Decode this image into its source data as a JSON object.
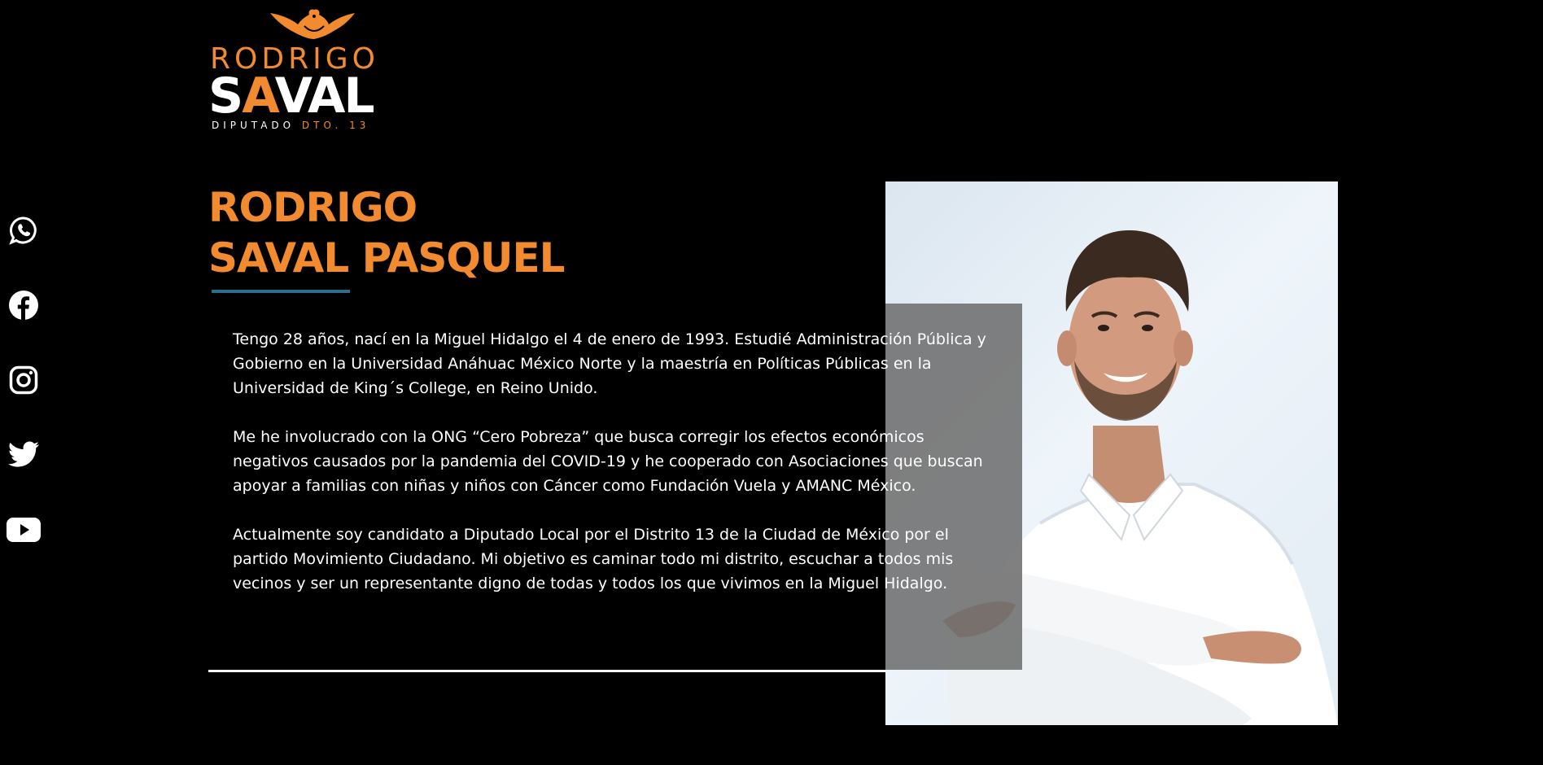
{
  "brand": {
    "logo_line1": "RODRIGO",
    "logo_line2_a": "S",
    "logo_line2_b": "A",
    "logo_line2_c": "VAL",
    "logo_line3_a": "DIPUTADO",
    "logo_line3_b": "DTO. 13",
    "accent_color": "#f28a30",
    "underline_color": "#2a6f8e"
  },
  "social": [
    {
      "name": "whatsapp",
      "icon": "whatsapp-icon"
    },
    {
      "name": "facebook",
      "icon": "facebook-icon"
    },
    {
      "name": "instagram",
      "icon": "instagram-icon"
    },
    {
      "name": "twitter",
      "icon": "twitter-icon"
    },
    {
      "name": "youtube",
      "icon": "youtube-icon"
    }
  ],
  "heading": {
    "line1": "RODRIGO",
    "line2": "SAVAL PASQUEL"
  },
  "bio": {
    "p1": "Tengo 28 años, nací en la Miguel Hidalgo el 4 de enero de 1993. Estudié Administración Pública y Gobierno en la Universidad Anáhuac México Norte y la maestría en Políticas Públicas en la Universidad de King´s College, en Reino Unido.",
    "p2": "Me he involucrado con la ONG “Cero Pobreza” que busca corregir los efectos económicos negativos causados por la pandemia del COVID-19 y he cooperado con Asociaciones que buscan apoyar a familias con niñas y niños con Cáncer como Fundación Vuela y AMANC México.",
    "p3": "Actualmente soy candidato a Diputado Local por el Distrito 13 de la Ciudad de México por el partido Movimiento Ciudadano. Mi objetivo es caminar todo mi distrito, escuchar a todos mis vecinos y ser un representante digno de todas y todos los que vivimos en la Miguel Hidalgo."
  }
}
